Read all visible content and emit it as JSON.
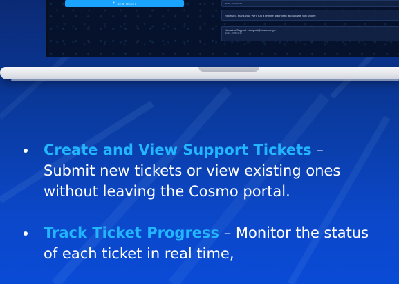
{
  "laptop": {
    "new_ticket_button": {
      "label": "NEW TICKET",
      "icon": "plus-icon"
    },
    "messages": [
      {
        "meta": "Jul 10, 2025 14:48",
        "text": ""
      },
      {
        "meta": "",
        "text": "Received, thank you. We'll run a remote diagnostic and update you shortly."
      },
      {
        "meta": "Jul 10, 2025 14:49",
        "text": "Navarino Support <support@navarino.gr>"
      }
    ]
  },
  "features": [
    {
      "title": "Create and View Support Tickets",
      "separator": " – ",
      "description": "Submit new tickets or view existing ones without leaving the Cosmo portal."
    },
    {
      "title": "Track Ticket Progress",
      "separator": " – ",
      "description": "Monitor the status of each ticket in real time,"
    }
  ],
  "colors": {
    "background_top": "#0b2a74",
    "background_bottom": "#0a4bd6",
    "accent": "#21b6ff",
    "button": "#1aa4ff",
    "text": "#ffffff"
  }
}
